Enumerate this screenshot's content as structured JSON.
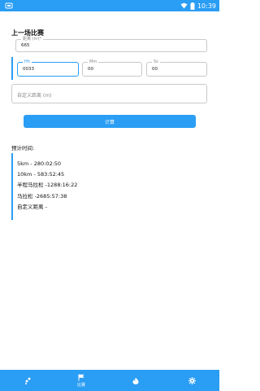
{
  "status_bar": {
    "time": "10:39",
    "icons": [
      "app-indicator-icon",
      "wifi-icon",
      "battery-icon"
    ]
  },
  "section": {
    "title": "上一场比赛"
  },
  "distance_field": {
    "label": "距离 (m)*",
    "value": "665"
  },
  "time_fields": [
    {
      "label": "Hh",
      "value": "0033"
    },
    {
      "label": "Mm",
      "value": "00"
    },
    {
      "label": "Ss",
      "value": "00"
    }
  ],
  "custom_distance": {
    "placeholder": "自定义距离 (m)"
  },
  "calculate_button": {
    "label": "计算"
  },
  "predictions": {
    "title": "预计时间:",
    "items": [
      "5km - 280:02:50",
      "10km - 583:52:45",
      "半程马拉松 -1288:16:22",
      "马拉松 -2685:57:38",
      "自定义距离 -"
    ]
  },
  "bottom_nav": {
    "items": [
      {
        "icon": "runner-dots-icon",
        "label": ""
      },
      {
        "icon": "flag-icon",
        "label": "比赛"
      },
      {
        "icon": "fire-icon",
        "label": ""
      },
      {
        "icon": "gear-icon",
        "label": ""
      }
    ],
    "active_index": 1
  },
  "colors": {
    "accent": "#2a9df4",
    "background": "#ffffff",
    "text": "#111111"
  }
}
